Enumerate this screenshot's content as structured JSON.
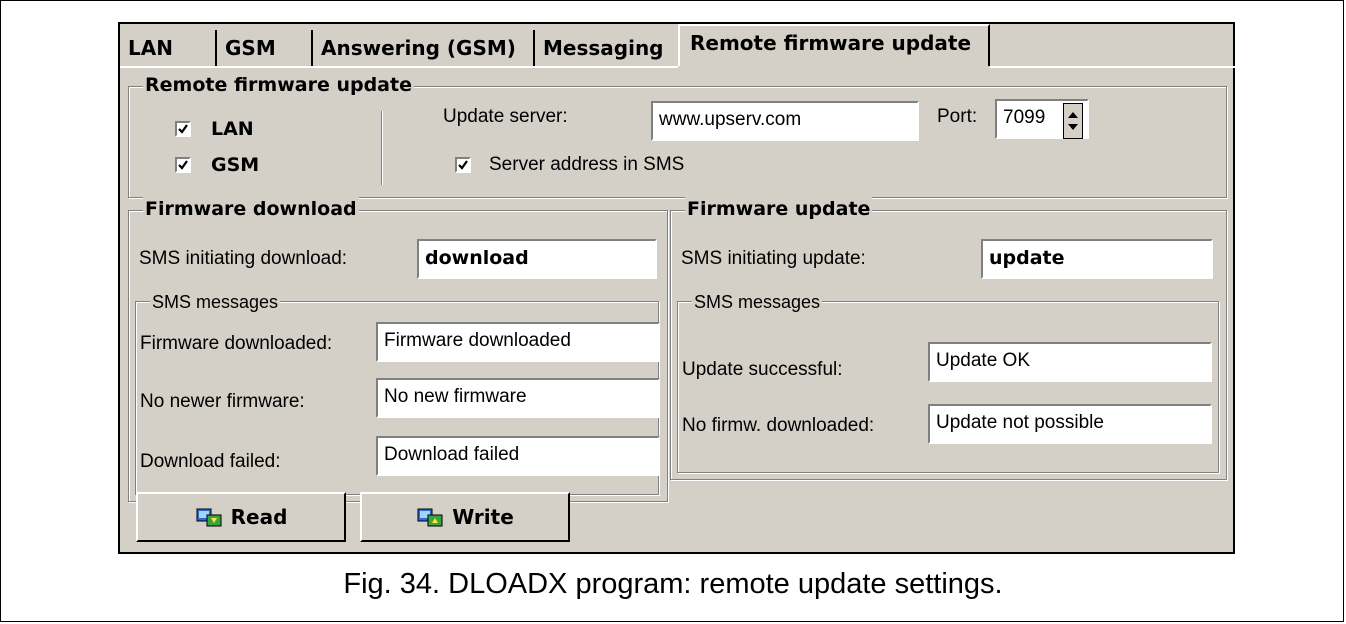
{
  "tabs": [
    {
      "label": "LAN"
    },
    {
      "label": "GSM"
    },
    {
      "label": "Answering (GSM)"
    },
    {
      "label": "Messaging"
    },
    {
      "label": "Remote firmware update",
      "active": true
    }
  ],
  "remote_update": {
    "title": "Remote firmware update",
    "lan_label": "LAN",
    "lan_checked": true,
    "gsm_label": "GSM",
    "gsm_checked": true,
    "server_label": "Update server:",
    "server_value": "www.upserv.com",
    "port_label": "Port:",
    "port_value": "7099",
    "sms_addr_label": "Server address in SMS",
    "sms_addr_checked": true
  },
  "download": {
    "title": "Firmware download",
    "sms_init_label": "SMS initiating download:",
    "sms_init_value": "download",
    "sms_group_title": "SMS messages",
    "rows": [
      {
        "label": "Firmware downloaded:",
        "value": "Firmware downloaded"
      },
      {
        "label": "No newer firmware:",
        "value": "No new firmware"
      },
      {
        "label": "Download failed:",
        "value": "Download failed"
      }
    ]
  },
  "update": {
    "title": "Firmware update",
    "sms_init_label": "SMS initiating update:",
    "sms_init_value": "update",
    "sms_group_title": "SMS messages",
    "rows": [
      {
        "label": "Update successful:",
        "value": "Update OK"
      },
      {
        "label": "No firmw. downloaded:",
        "value": "Update not possible"
      }
    ]
  },
  "buttons": {
    "read": "Read",
    "write": "Write"
  },
  "caption": "Fig. 34. DLOADX program: remote update settings."
}
